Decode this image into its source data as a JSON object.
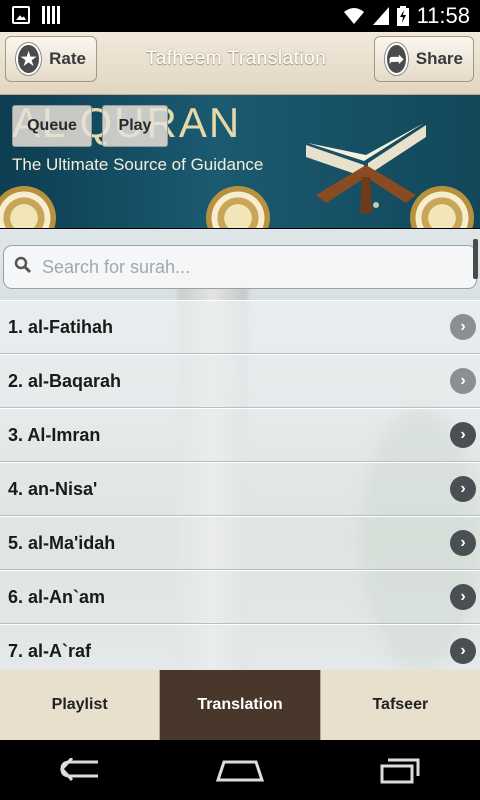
{
  "status_bar": {
    "time": "11:58"
  },
  "header": {
    "title": "Tafheem Translation",
    "rate_label": "Rate",
    "share_label": "Share"
  },
  "banner": {
    "logo_text": "AL QURAN",
    "tagline": "The Ultimate Source of Guidance",
    "queue_label": "Queue",
    "play_label": "Play"
  },
  "search": {
    "placeholder": "Search for surah..."
  },
  "surahs": [
    {
      "label": "1. al-Fatihah"
    },
    {
      "label": "2. al-Baqarah"
    },
    {
      "label": "3. Al-Imran"
    },
    {
      "label": "4. an-Nisa'"
    },
    {
      "label": "5. al-Ma'idah"
    },
    {
      "label": "6. al-An`am"
    },
    {
      "label": "7. al-A`raf"
    }
  ],
  "tabs": [
    {
      "label": "Playlist"
    },
    {
      "label": "Translation"
    },
    {
      "label": "Tafseer"
    }
  ],
  "colors": {
    "active_tab": "#4a372b",
    "banner": "#1b5a71"
  }
}
